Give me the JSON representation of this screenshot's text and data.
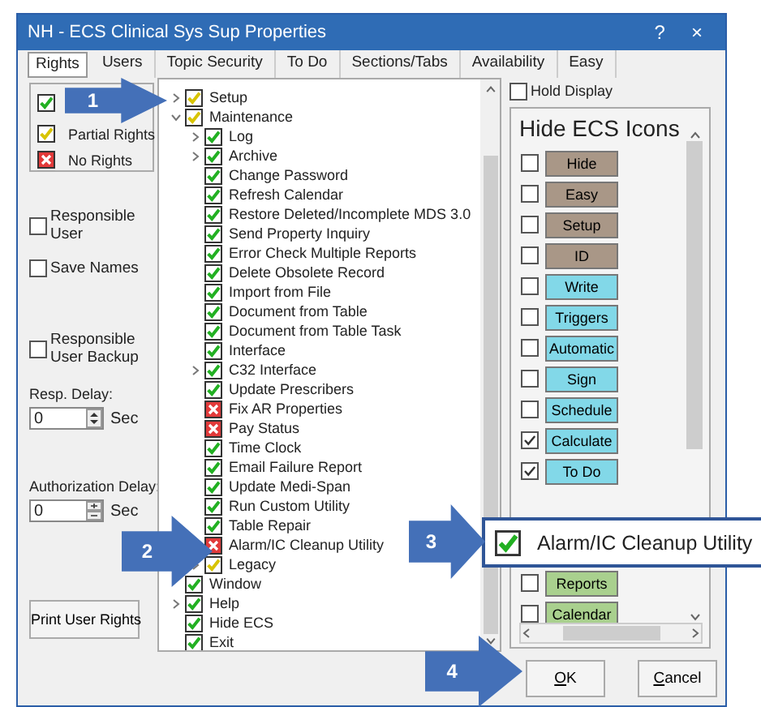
{
  "window": {
    "title": "NH - ECS Clinical Sys Sup Properties",
    "help": "?",
    "close": "×"
  },
  "tabs": [
    {
      "label": "Rights",
      "selected": true
    },
    {
      "label": "Users",
      "selected": false
    },
    {
      "label": "Topic Security",
      "selected": false
    },
    {
      "label": "To Do",
      "selected": false
    },
    {
      "label": "Sections/Tabs",
      "selected": false
    },
    {
      "label": "Availability",
      "selected": false
    },
    {
      "label": "Easy",
      "selected": false
    }
  ],
  "legend": [
    {
      "kind": "full"
    },
    {
      "kind": "partial",
      "label": "Partial Rights"
    },
    {
      "kind": "none",
      "label": "No Rights"
    }
  ],
  "options": [
    {
      "label": "Responsible User",
      "checked": false
    },
    {
      "label": "Save Names",
      "checked": false
    },
    {
      "label": "Responsible User Backup",
      "checked": false
    }
  ],
  "delays": [
    {
      "label": "Resp. Delay:",
      "value": "0",
      "unit": "Sec",
      "kind": "arrows"
    },
    {
      "label": "Authorization Delay:",
      "value": "0",
      "unit": "Sec",
      "kind": "plusminus"
    }
  ],
  "print_button": "Print User Rights",
  "tree": {
    "items": [
      {
        "label": "Setup",
        "kind": "partial",
        "expanded": false
      },
      {
        "label": "Maintenance",
        "kind": "partial",
        "expanded": true,
        "children": [
          {
            "label": "Log",
            "kind": "full",
            "expanded": false
          },
          {
            "label": "Archive",
            "kind": "full",
            "expanded": false
          },
          {
            "label": "Change Password",
            "kind": "full"
          },
          {
            "label": "Refresh Calendar",
            "kind": "full"
          },
          {
            "label": "Restore Deleted/Incomplete MDS 3.0",
            "kind": "full"
          },
          {
            "label": "Send Property Inquiry",
            "kind": "full"
          },
          {
            "label": "Error Check Multiple Reports",
            "kind": "full"
          },
          {
            "label": "Delete Obsolete Record",
            "kind": "full"
          },
          {
            "label": "Import from File",
            "kind": "full"
          },
          {
            "label": "Document from Table",
            "kind": "full"
          },
          {
            "label": "Document from Table Task",
            "kind": "full"
          },
          {
            "label": "Interface",
            "kind": "full"
          },
          {
            "label": "C32 Interface",
            "kind": "full",
            "expanded": false
          },
          {
            "label": "Update Prescribers",
            "kind": "full"
          },
          {
            "label": "Fix AR Properties",
            "kind": "none"
          },
          {
            "label": "Pay Status",
            "kind": "none"
          },
          {
            "label": "Time Clock",
            "kind": "full"
          },
          {
            "label": "Email Failure Report",
            "kind": "full"
          },
          {
            "label": "Update Medi-Span",
            "kind": "full"
          },
          {
            "label": "Run Custom Utility",
            "kind": "full"
          },
          {
            "label": "Table Repair",
            "kind": "full"
          },
          {
            "label": "Alarm/IC Cleanup Utility",
            "kind": "none"
          },
          {
            "label": "Legacy",
            "kind": "partial",
            "expanded": false
          }
        ]
      },
      {
        "label": "Window",
        "kind": "full"
      },
      {
        "label": "Help",
        "kind": "full",
        "expanded": false
      },
      {
        "label": "Hide ECS",
        "kind": "full"
      },
      {
        "label": "Exit",
        "kind": "full"
      }
    ]
  },
  "hold_display": {
    "label": "Hold Display",
    "checked": false
  },
  "icons_panel": {
    "title": "Hide ECS Icons",
    "items": [
      {
        "label": "Hide",
        "checked": false,
        "color": "#a99787"
      },
      {
        "label": "Easy",
        "checked": false,
        "color": "#a99787"
      },
      {
        "label": "Setup",
        "checked": false,
        "color": "#a99787"
      },
      {
        "label": "ID",
        "checked": false,
        "color": "#a99787"
      },
      {
        "label": "Write",
        "checked": false,
        "color": "#82d8e8"
      },
      {
        "label": "Triggers",
        "checked": false,
        "color": "#82d8e8"
      },
      {
        "label": "Automatic",
        "checked": false,
        "color": "#82d8e8"
      },
      {
        "label": "Sign",
        "checked": false,
        "color": "#82d8e8"
      },
      {
        "label": "Schedule",
        "checked": false,
        "color": "#82d8e8"
      },
      {
        "label": "Calculate",
        "checked": true,
        "color": "#82d8e8"
      },
      {
        "label": "To Do",
        "checked": true,
        "color": "#82d8e8"
      },
      {
        "kind": "hidden"
      },
      {
        "kind": "hidden"
      },
      {
        "label": "Reports",
        "checked": false,
        "color": "#a9d08e"
      },
      {
        "label": "Calendar",
        "checked": false,
        "color": "#a9d08e"
      }
    ]
  },
  "zoom_callout": {
    "kind": "full",
    "label": "Alarm/IC Cleanup Utility"
  },
  "steps": [
    {
      "number": "1"
    },
    {
      "number": "2"
    },
    {
      "number": "3"
    },
    {
      "number": "4"
    }
  ],
  "buttons": [
    {
      "label": "OK"
    },
    {
      "label": "Cancel"
    }
  ]
}
